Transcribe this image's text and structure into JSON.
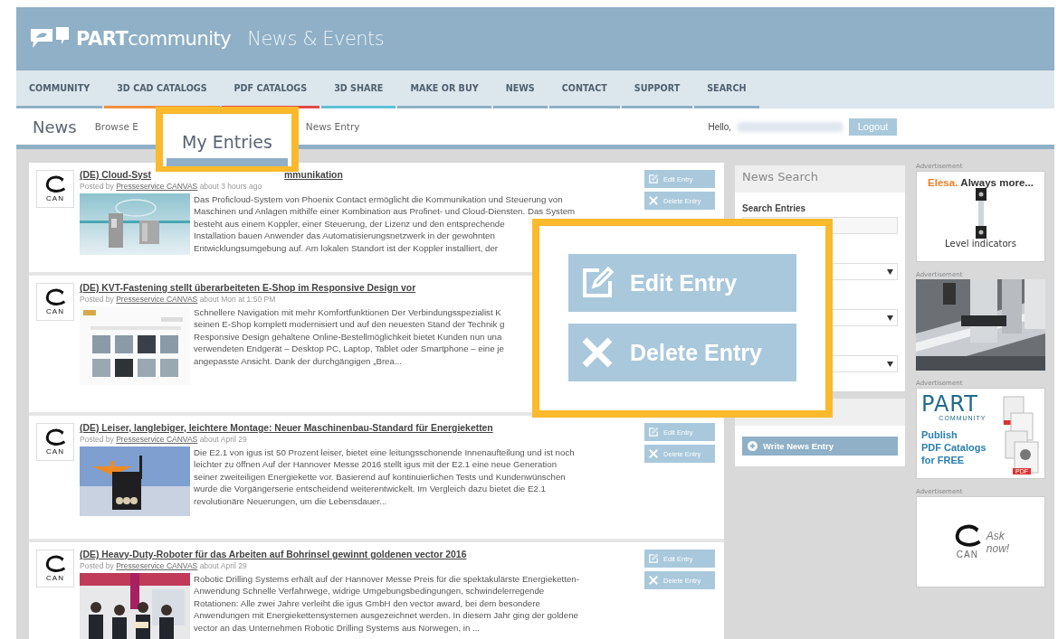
{
  "header": {
    "logo_bold": "PART",
    "logo_light": "community",
    "section_title": "News & Events"
  },
  "nav": [
    {
      "label": "COMMUNITY",
      "color": "#8fb0c6"
    },
    {
      "label": "3D CAD CATALOGS",
      "color": "#f0913a"
    },
    {
      "label": "PDF CATALOGS",
      "color": "#e24a4a"
    },
    {
      "label": "3D SHARE",
      "color": "#5cc0d8"
    },
    {
      "label": "MAKE OR BUY",
      "color": "#8fb0c6"
    },
    {
      "label": "NEWS",
      "color": "#8fb0c6"
    },
    {
      "label": "CONTACT",
      "color": "#8fb0c6"
    },
    {
      "label": "SUPPORT",
      "color": "#8fb0c6"
    },
    {
      "label": "SEARCH",
      "color": "#8fb0c6"
    }
  ],
  "subnav": {
    "title": "News",
    "link_before": "Browse E",
    "link_after": "News Entry",
    "greeting": "Hello,",
    "logout": "Logout"
  },
  "entries": [
    {
      "title": "(DE) Cloud-Syst",
      "title_tail": "mmunikation",
      "posted_by": "Posted by",
      "author": "Presseservice CANVAS",
      "time": "about 3 hours ago",
      "avatar_label": "CAN",
      "body_lines": [
        "Das Proficloud-System von Phoenix Contact ermöglicht die Kommunikation und Steuerung von",
        "Maschinen und Anlagen mithilfe einer Kombination aus Profinet- und Cloud-Diensten. Das System",
        "besteht aus einem Koppler, einer Steuerung, der Lizenz und den entsprechende",
        "Installation bauen Anwender das Automatisierungsnetzwerk in der gewohnten",
        "Entwicklungsumgebung auf. Am lokalen Standort ist der Koppler installiert, der"
      ],
      "actions": [
        {
          "label": "Edit Entry",
          "kind": "edit"
        },
        {
          "label": "Delete Entry",
          "kind": "delete"
        }
      ]
    },
    {
      "title": "(DE) KVT-Fastening stellt überarbeiteten E-Shop im Responsive Design vor",
      "posted_by": "Posted by",
      "author": "Presseservice CANVAS",
      "time": "about Mon at 1:50 PM",
      "avatar_label": "CAN",
      "body_lines": [
        "Schnellere Navigation mit mehr Komfortfunktionen Der Verbindungsspezialist K",
        "seinen E-Shop komplett modernisiert und auf den neuesten Stand der Technik g",
        "Responsive Design gehaltene Online-Bestellmöglichkeit bietet Kunden nun una",
        "verwendeten Endgerät – Desktop PC, Laptop, Tablet oder Smartphone – eine je",
        "angepasste Ansicht. Dank der durchgängigen „Brea..."
      ]
    },
    {
      "title": "(DE) Leiser, langlebiger, leichtere Montage: Neuer Maschinenbau-Standard für Energieketten",
      "posted_by": "Posted by",
      "author": "Presseservice CANVAS",
      "time": "about April 29",
      "avatar_label": "CAN",
      "body_lines": [
        "Die E2.1 von igus ist 50 Prozent leiser, bietet eine leitungsschonende Innenaufteilung und ist noch",
        "leichter zu öffnen   Auf der Hannover Messe 2016 stellt igus mit der E2.1 eine neue Generation",
        "seiner zweiteiligen Energiekette vor. Basierend auf kontinuierlichen Tests und Kundenwünschen",
        "wurde die Vorgängerserie entscheidend weiterentwickelt. Im Vergleich dazu bietet die E2.1",
        "revolutionäre Neuerungen, um die Lebensdauer..."
      ],
      "actions": [
        {
          "label": "Edit Entry",
          "kind": "edit"
        },
        {
          "label": "Delete Entry",
          "kind": "delete"
        }
      ]
    },
    {
      "title": "(DE) Heavy-Duty-Roboter für das Arbeiten auf Bohrinsel gewinnt goldenen vector 2016",
      "posted_by": "Posted by",
      "author": "Presseservice CANVAS",
      "time": "about April 29",
      "avatar_label": "CAN",
      "body_lines": [
        "Robotic Drilling Systems erhält auf der Hannover Messe Preis für die spektakulärste Energieketten-",
        "Anwendung   Schnelle Verfahrwege, widrige Umgebungsbedingungen, schwindelerregende",
        "Rotationen: Alle zwei Jahre verleiht die igus GmbH den vector award, bei dem besondere",
        "Anwendungen mit Energiekettensystemen ausgezeichnet werden. In diesem Jahr ging der goldene",
        "vector an das Unternehmen Robotic Drilling Systems aus Norwegen, in ..."
      ],
      "actions": [
        {
          "label": "Edit Entry",
          "kind": "edit"
        },
        {
          "label": "Delete Entry",
          "kind": "delete"
        }
      ]
    }
  ],
  "news_search": {
    "title": "News Search",
    "search_label": "Search Entries",
    "write_button": "Write News Entry"
  },
  "ads": [
    {
      "label": "Advertisement",
      "kind": "elesa",
      "brand": "Elesa.",
      "tagline": "Always more...",
      "caption": "Level indicators"
    },
    {
      "label": "Advertisement",
      "kind": "picture"
    },
    {
      "label": "Advertisement",
      "kind": "partcommunity",
      "logo": "PART",
      "logo_sub": "COMMUNITY",
      "text_lines": [
        "Publish",
        "PDF Catalogs",
        "for FREE"
      ],
      "file_label": "PDF"
    },
    {
      "label": "Advertisement",
      "kind": "can",
      "logo": "CAN",
      "text_lines": [
        "Ask",
        "now!"
      ]
    }
  ],
  "callouts": {
    "tab": {
      "label": "My Entries"
    },
    "actions": [
      {
        "label": "Edit Entry",
        "kind": "edit"
      },
      {
        "label": "Delete Entry",
        "kind": "delete"
      }
    ]
  }
}
